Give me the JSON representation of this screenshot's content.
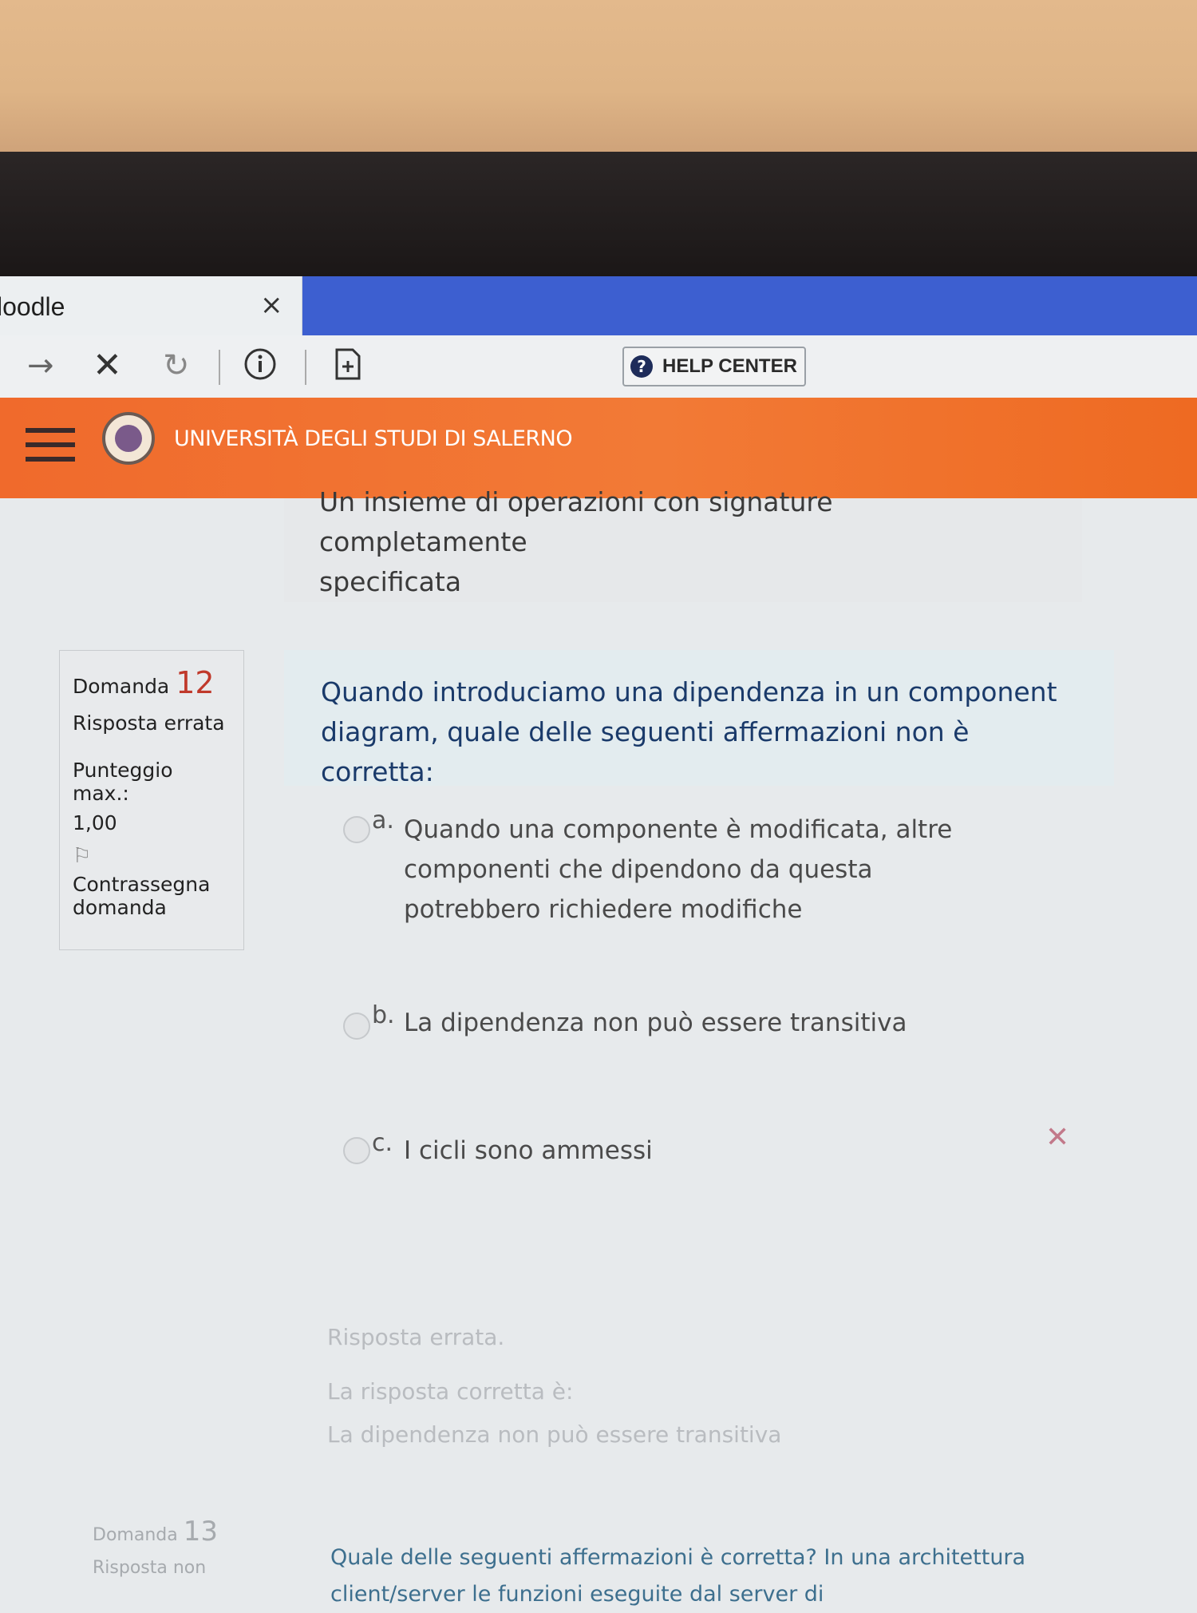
{
  "browser": {
    "tab_title": "loodle",
    "tab_close_icon": "close-icon",
    "toolbar": {
      "help_label": "HELP CENTER"
    }
  },
  "site": {
    "name": "UNIVERSITÀ DEGLI STUDI DI SALERNO"
  },
  "previous_answer": {
    "line1": "Un insieme di operazioni con signature completamente",
    "line2": "specificata"
  },
  "question12": {
    "label": "Domanda",
    "number": "12",
    "status": "Risposta errata",
    "score_label": "Punteggio max.:",
    "score_value": "1,00",
    "flag_label_1": "Contrassegna",
    "flag_label_2": "domanda",
    "text": "Quando introduciamo una dipendenza in un component diagram, quale delle seguenti affermazioni non è corretta:",
    "options": [
      {
        "letter": "a.",
        "text": "Quando una componente è modificata, altre componenti che dipendono da questa potrebbero richiedere modifiche"
      },
      {
        "letter": "b.",
        "text": "La dipendenza non può essere transitiva"
      },
      {
        "letter": "c.",
        "text": "I cicli sono ammessi"
      }
    ],
    "feedback_status": "Risposta errata.",
    "feedback_correct_intro": "La risposta corretta è:",
    "feedback_correct_text": "La dipendenza non può essere transitiva"
  },
  "question13": {
    "label": "Domanda",
    "number": "13",
    "status": "Risposta non",
    "text": "Quale delle seguenti affermazioni è corretta? In una architettura client/server le funzioni eseguite dal server di"
  }
}
